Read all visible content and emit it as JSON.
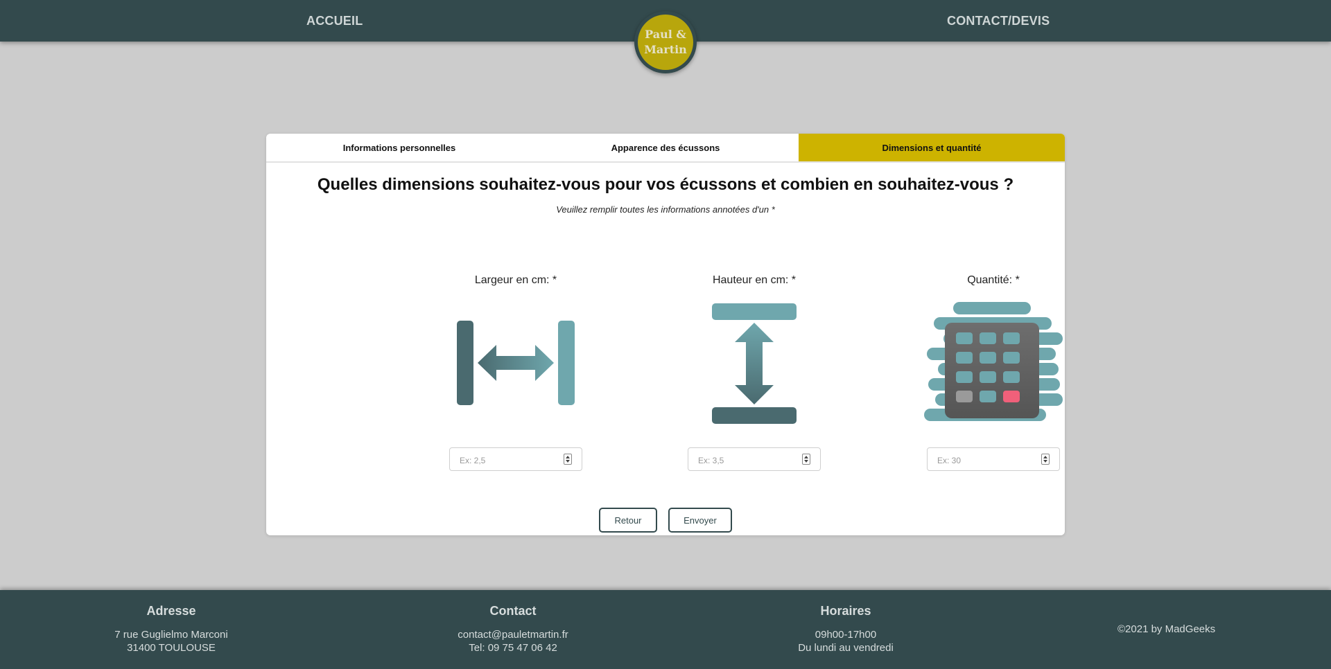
{
  "nav": {
    "home": "ACCUEIL",
    "contact": "CONTACT/DEVIS",
    "logo_line1": "Paul &",
    "logo_line2": "Martin"
  },
  "tabs": [
    {
      "label": "Informations personnelles",
      "active": false
    },
    {
      "label": "Apparence des écussons",
      "active": false
    },
    {
      "label": "Dimensions et quantité",
      "active": true
    }
  ],
  "form": {
    "question": "Quelles dimensions souhaitez-vous pour vos écussons et combien en souhaitez-vous ?",
    "hint": "Veuillez remplir toutes les informations annotées d'un *",
    "fields": [
      {
        "label": "Largeur en cm: *",
        "placeholder": "Ex: 2,5",
        "icon": "width-arrows-icon"
      },
      {
        "label": "Hauteur en cm: *",
        "placeholder": "Ex: 3,5",
        "icon": "height-arrows-icon"
      },
      {
        "label": "Quantité: *",
        "placeholder": "Ex: 30",
        "icon": "calculator-icon"
      }
    ],
    "back_label": "Retour",
    "send_label": "Envoyer"
  },
  "footer": {
    "address": {
      "title": "Adresse",
      "line1": "7 rue Guglielmo Marconi",
      "line2": "31400 TOULOUSE"
    },
    "contact": {
      "title": "Contact",
      "line1": "contact@pauletmartin.fr",
      "line2": "Tel: 09 75 47 06 42"
    },
    "hours": {
      "title": "Horaires",
      "line1": "09h00-17h00",
      "line2": "Du lundi au vendredi"
    },
    "copyright": "©2021 by MadGeeks"
  },
  "colors": {
    "nav_bg": "#334a4d",
    "accent": "#cdb300",
    "icon_teal": "#6fa7ad",
    "page_bg": "#cccccc"
  }
}
